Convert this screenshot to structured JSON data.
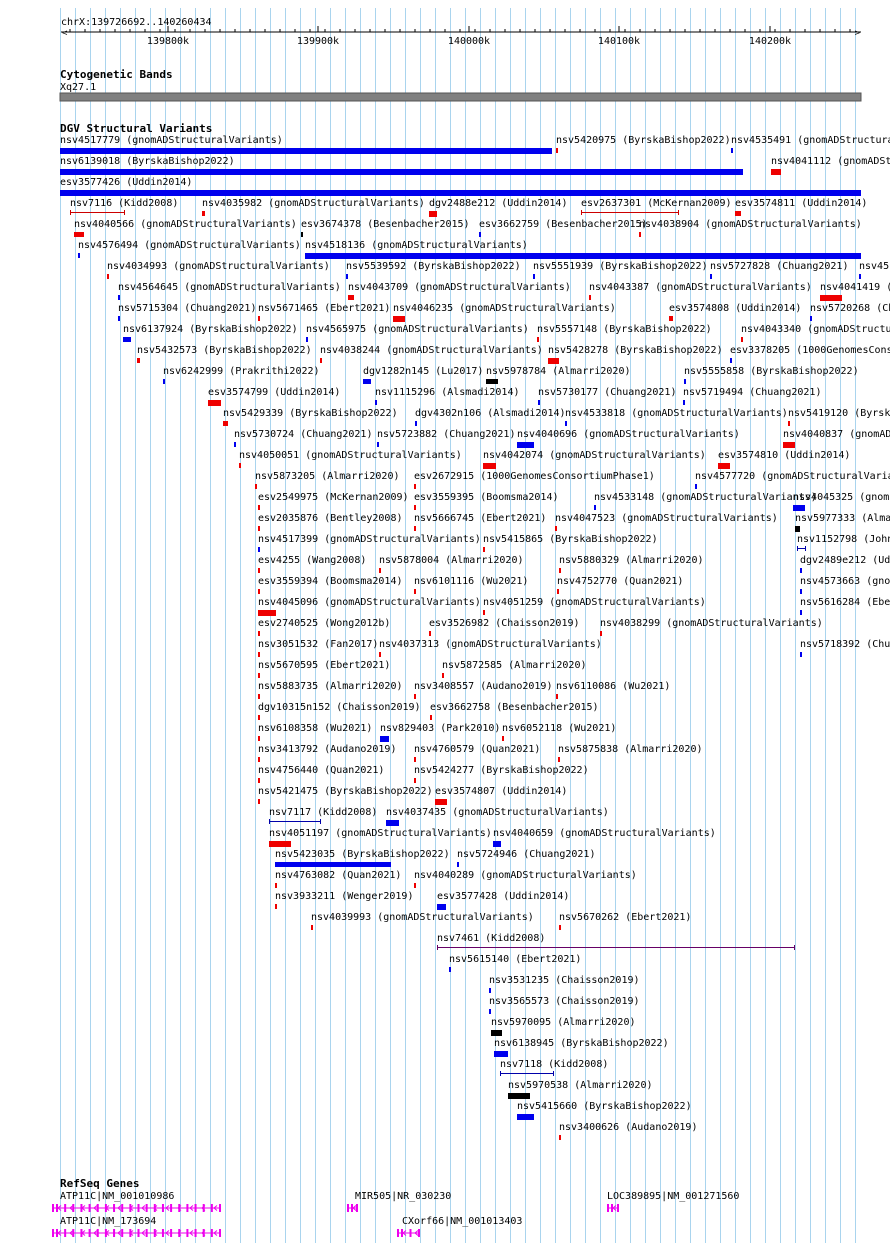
{
  "ruler": {
    "location": "chrX:139726692..140260434",
    "ticks": [
      "139800k",
      "139900k",
      "140000k",
      "140100k",
      "140200k"
    ]
  },
  "cytobands": {
    "title": "Cytogenetic Bands",
    "band": "Xq27.1"
  },
  "dgv": {
    "title": "DGV Structural Variants",
    "colors": {
      "blue": "#0000ee",
      "red": "#ee0000",
      "black": "#000000",
      "span": "#cc0000",
      "span_blue": "#0000aa",
      "span_purple": "#660066"
    },
    "features": [
      {
        "label": "nsv4517779 (gnomADStructuralVariants)",
        "color": "blue"
      },
      {
        "label": "nsv5420975 (ByrskaBishop2022)",
        "color": "red"
      },
      {
        "label": "nsv4535491 (gnomADStructuralVariants)",
        "color": "blue"
      },
      {
        "label": "nsv6139018 (ByrskaBishop2022)",
        "color": "blue"
      },
      {
        "label": "nsv4041112 (gnomADStructuralVariants)",
        "color": "red"
      },
      {
        "label": "esv3577426 (Uddin2014)",
        "color": "blue"
      },
      {
        "label": "nsv7116 (Kidd2008)",
        "color": "span"
      },
      {
        "label": "nsv4035982 (gnomADStructuralVariants)",
        "color": "red"
      },
      {
        "label": "dgv2488e212 (Uddin2014)",
        "color": "red"
      },
      {
        "label": "esv2637301 (McKernan2009)",
        "color": "span"
      },
      {
        "label": "esv3574811 (Uddin2014)",
        "color": "red"
      },
      {
        "label": "nsv4040566 (gnomADStructuralVariants)",
        "color": "red"
      },
      {
        "label": "esv3674378 (Besenbacher2015)",
        "color": "black"
      },
      {
        "label": "esv3662759 (Besenbacher2015)",
        "color": "blue"
      },
      {
        "label": "nsv4038904 (gnomADStructuralVariants)",
        "color": "red"
      },
      {
        "label": "nsv4576494 (gnomADStructuralVariants)",
        "color": "blue"
      },
      {
        "label": "nsv4518136 (gnomADStructuralVariants)",
        "color": "blue"
      },
      {
        "label": "nsv4034993 (gnomADStructuralVariants)",
        "color": "red"
      },
      {
        "label": "nsv5539592 (ByrskaBishop2022)",
        "color": "blue"
      },
      {
        "label": "nsv5551939 (ByrskaBishop2022)",
        "color": "blue"
      },
      {
        "label": "nsv5727828 (Chuang2021)",
        "color": "blue"
      },
      {
        "label": "nsv45",
        "color": "blue"
      },
      {
        "label": "nsv4564645 (gnomADStructuralVariants)",
        "color": "blue"
      },
      {
        "label": "nsv4043709 (gnomADStructuralVariants)",
        "color": "red"
      },
      {
        "label": "nsv4043387 (gnomADStructuralVariants)",
        "color": "red"
      },
      {
        "label": "nsv4041419 (",
        "color": "red"
      },
      {
        "label": "nsv5715304 (Chuang2021)",
        "color": "blue"
      },
      {
        "label": "nsv5671465 (Ebert2021)",
        "color": "red"
      },
      {
        "label": "nsv4046235 (gnomADStructuralVariants)",
        "color": "red"
      },
      {
        "label": "esv3574808 (Uddin2014)",
        "color": "red"
      },
      {
        "label": "nsv5720268 (Ch",
        "color": "blue"
      },
      {
        "label": "nsv6137924 (ByrskaBishop2022)",
        "color": "blue"
      },
      {
        "label": "nsv4565975 (gnomADStructuralVariants)",
        "color": "blue"
      },
      {
        "label": "nsv5557148 (ByrskaBishop2022)",
        "color": "red"
      },
      {
        "label": "nsv4043340 (gnomADStructuralV",
        "color": "red"
      },
      {
        "label": "nsv5432573 (ByrskaBishop2022)",
        "color": "red"
      },
      {
        "label": "nsv4038244 (gnomADStructuralVariants)",
        "color": "red"
      },
      {
        "label": "nsv5428278 (ByrskaBishop2022)",
        "color": "red"
      },
      {
        "label": "esv3378205 (1000GenomesCons",
        "color": "blue"
      },
      {
        "label": "nsv6242999 (Prakrithi2022)",
        "color": "blue"
      },
      {
        "label": "dgv1282n145 (Lu2017)",
        "color": "blue"
      },
      {
        "label": "nsv5978784 (Almarri2020)",
        "color": "black"
      },
      {
        "label": "nsv5555858 (ByrskaBishop2022)",
        "color": "blue"
      },
      {
        "label": "esv3574799 (Uddin2014)",
        "color": "red"
      },
      {
        "label": "nsv1115296 (Alsmadi2014)",
        "color": "blue"
      },
      {
        "label": "nsv5730177 (Chuang2021)",
        "color": "blue"
      },
      {
        "label": "nsv5719494 (Chuang2021)",
        "color": "blue"
      },
      {
        "label": "nsv5429339 (ByrskaBishop2022)",
        "color": "red"
      },
      {
        "label": "dgv4302n106 (Alsmadi2014)",
        "color": "blue"
      },
      {
        "label": "nsv4533818 (gnomADStructuralVariants)",
        "color": "blue"
      },
      {
        "label": "nsv5419120 (Byrsk",
        "color": "red"
      },
      {
        "label": "nsv5730724 (Chuang2021)",
        "color": "blue"
      },
      {
        "label": "nsv5723882 (Chuang2021)",
        "color": "blue"
      },
      {
        "label": "nsv4040696 (gnomADStructuralVariants)",
        "color": "blue"
      },
      {
        "label": "nsv4040837 (gnomADS",
        "color": "red"
      },
      {
        "label": "nsv4050051 (gnomADStructuralVariants)",
        "color": "red"
      },
      {
        "label": "nsv4042074 (gnomADStructuralVariants)",
        "color": "red"
      },
      {
        "label": "esv3574810 (Uddin2014)",
        "color": "red"
      },
      {
        "label": "nsv5873205 (Almarri2020)",
        "color": "red"
      },
      {
        "label": "esv2672915 (1000GenomesConsortiumPhase1)",
        "color": "red"
      },
      {
        "label": "nsv4577720 (gnomADStructuralVaria",
        "color": "blue"
      },
      {
        "label": "esv2549975 (McKernan2009)",
        "color": "red"
      },
      {
        "label": "esv3559395 (Boomsma2014)",
        "color": "red"
      },
      {
        "label": "nsv4533148 (gnomADStructuralVariants)",
        "color": "blue"
      },
      {
        "label": "nsv4045325 (gnom",
        "color": "blue"
      },
      {
        "label": "esv2035876 (Bentley2008)",
        "color": "red"
      },
      {
        "label": "nsv5666745 (Ebert2021)",
        "color": "red"
      },
      {
        "label": "nsv4047523 (gnomADStructuralVariants)",
        "color": "red"
      },
      {
        "label": "nsv5977333 (Alma",
        "color": "black"
      },
      {
        "label": "nsv4517399 (gnomADStructuralVariants)",
        "color": "blue"
      },
      {
        "label": "nsv5415865 (ByrskaBishop2022)",
        "color": "red"
      },
      {
        "label": "nsv1152798 (John",
        "color": "span_blue"
      },
      {
        "label": "esv4255 (Wang2008)",
        "color": "red"
      },
      {
        "label": "nsv5878004 (Almarri2020)",
        "color": "red"
      },
      {
        "label": "nsv5880329 (Almarri2020)",
        "color": "red"
      },
      {
        "label": "dgv2489e212 (Udd",
        "color": "blue"
      },
      {
        "label": "esv3559394 (Boomsma2014)",
        "color": "red"
      },
      {
        "label": "nsv6101116 (Wu2021)",
        "color": "red"
      },
      {
        "label": "nsv4752770 (Quan2021)",
        "color": "red"
      },
      {
        "label": "nsv4573663 (gno",
        "color": "blue"
      },
      {
        "label": "nsv4045096 (gnomADStructuralVariants)",
        "color": "red"
      },
      {
        "label": "nsv4051259 (gnomADStructuralVariants)",
        "color": "red"
      },
      {
        "label": "nsv5616284 (Ebe",
        "color": "blue"
      },
      {
        "label": "esv2740525 (Wong2012b)",
        "color": "red"
      },
      {
        "label": "esv3526982 (Chaisson2019)",
        "color": "red"
      },
      {
        "label": "nsv4038299 (gnomADStructuralVariants)",
        "color": "red"
      },
      {
        "label": "nsv3051532 (Fan2017)",
        "color": "red"
      },
      {
        "label": "nsv4037313 (gnomADStructuralVariants)",
        "color": "red"
      },
      {
        "label": "nsv5718392 (Chu",
        "color": "blue"
      },
      {
        "label": "nsv5670595 (Ebert2021)",
        "color": "red"
      },
      {
        "label": "nsv5872585 (Almarri2020)",
        "color": "red"
      },
      {
        "label": "nsv5883735 (Almarri2020)",
        "color": "red"
      },
      {
        "label": "nsv3408557 (Audano2019)",
        "color": "red"
      },
      {
        "label": "nsv6110086 (Wu2021)",
        "color": "red"
      },
      {
        "label": "dgv10315n152 (Chaisson2019)",
        "color": "red"
      },
      {
        "label": "esv3662758 (Besenbacher2015)",
        "color": "red"
      },
      {
        "label": "nsv6108358 (Wu2021)",
        "color": "red"
      },
      {
        "label": "nsv829403 (Park2010)",
        "color": "blue"
      },
      {
        "label": "nsv6052118 (Wu2021)",
        "color": "red"
      },
      {
        "label": "nsv3413792 (Audano2019)",
        "color": "red"
      },
      {
        "label": "nsv4760579 (Quan2021)",
        "color": "red"
      },
      {
        "label": "nsv5875838 (Almarri2020)",
        "color": "red"
      },
      {
        "label": "nsv4756440 (Quan2021)",
        "color": "red"
      },
      {
        "label": "nsv5424277 (ByrskaBishop2022)",
        "color": "red"
      },
      {
        "label": "nsv5421475 (ByrskaBishop2022)",
        "color": "red"
      },
      {
        "label": "esv3574807 (Uddin2014)",
        "color": "red"
      },
      {
        "label": "nsv7117 (Kidd2008)",
        "color": "span_blue"
      },
      {
        "label": "nsv4037435 (gnomADStructuralVariants)",
        "color": "blue"
      },
      {
        "label": "nsv4051197 (gnomADStructuralVariants)",
        "color": "red"
      },
      {
        "label": "nsv4040659 (gnomADStructuralVariants)",
        "color": "blue"
      },
      {
        "label": "nsv5423035 (ByrskaBishop2022)",
        "color": "blue"
      },
      {
        "label": "nsv5724946 (Chuang2021)",
        "color": "blue"
      },
      {
        "label": "nsv4763082 (Quan2021)",
        "color": "red"
      },
      {
        "label": "nsv4040289 (gnomADStructuralVariants)",
        "color": "red"
      },
      {
        "label": "nsv3933211 (Wenger2019)",
        "color": "red"
      },
      {
        "label": "esv3577428 (Uddin2014)",
        "color": "blue"
      },
      {
        "label": "nsv4039993 (gnomADStructuralVariants)",
        "color": "red"
      },
      {
        "label": "nsv5670262 (Ebert2021)",
        "color": "red"
      },
      {
        "label": "nsv7461 (Kidd2008)",
        "color": "span_purple"
      },
      {
        "label": "nsv5615140 (Ebert2021)",
        "color": "blue"
      },
      {
        "label": "nsv3531235 (Chaisson2019)",
        "color": "blue"
      },
      {
        "label": "nsv3565573 (Chaisson2019)",
        "color": "blue"
      },
      {
        "label": "nsv5970095 (Almarri2020)",
        "color": "black"
      },
      {
        "label": "nsv6138945 (ByrskaBishop2022)",
        "color": "blue"
      },
      {
        "label": "nsv7118 (Kidd2008)",
        "color": "span_blue"
      },
      {
        "label": "nsv5970538 (Almarri2020)",
        "color": "black"
      },
      {
        "label": "nsv5415660 (ByrskaBishop2022)",
        "color": "blue"
      },
      {
        "label": "nsv3400626 (Audano2019)",
        "color": "red"
      }
    ]
  },
  "refseq": {
    "title": "RefSeq Genes",
    "color": "#ee00ee",
    "genes": [
      {
        "label": "ATP11C|NM_001010986"
      },
      {
        "label": "MIR505|NR_030230"
      },
      {
        "label": "LOC389895|NM_001271560"
      },
      {
        "label": "ATP11C|NM_173694"
      },
      {
        "label": "CXorf66|NM_001013403"
      }
    ]
  }
}
